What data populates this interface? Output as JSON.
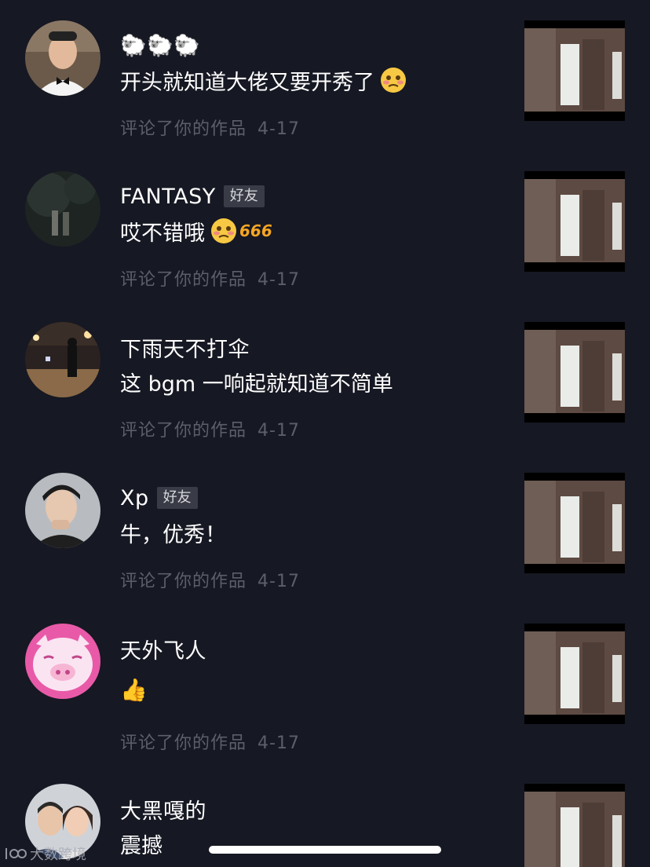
{
  "comments": [
    {
      "name": "🐑🐑🐑",
      "badge": "",
      "text": "开头就知道大佬又要开秀了",
      "emoji": "blush",
      "action": "评论了你的作品",
      "date": "4-17"
    },
    {
      "name": "FANTASY",
      "badge": "好友",
      "text": "哎不错哦",
      "emoji": "blush-666",
      "action": "评论了你的作品",
      "date": "4-17"
    },
    {
      "name": "下雨天不打伞",
      "badge": "",
      "text": "这 bgm 一响起就知道不简单",
      "emoji": "",
      "action": "评论了你的作品",
      "date": "4-17"
    },
    {
      "name": "Xp",
      "badge": "好友",
      "text": "牛，优秀！",
      "emoji": "",
      "action": "评论了你的作品",
      "date": "4-17"
    },
    {
      "name": "天外飞人",
      "badge": "",
      "text": "👍",
      "emoji": "",
      "action": "评论了你的作品",
      "date": "4-17"
    },
    {
      "name": "大黑嘎的",
      "badge": "",
      "text": "震撼",
      "emoji": "",
      "action": "",
      "date": ""
    }
  ],
  "emoji_extra": "666",
  "watermark": "大数跨境",
  "colors": {
    "background": "#161823",
    "meta_text": "#5c5e69",
    "badge_bg": "#393b46"
  }
}
